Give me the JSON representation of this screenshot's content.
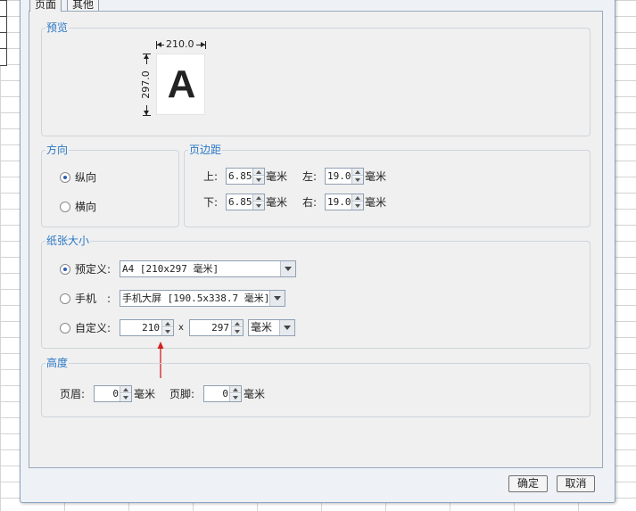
{
  "tabs": [
    {
      "label": "页面",
      "active": true
    },
    {
      "label": "其他",
      "active": false
    }
  ],
  "preview": {
    "title": "预览",
    "width_label": "210.0",
    "height_label": "297.0",
    "letter": "A"
  },
  "orientation": {
    "title": "方向",
    "portrait_label": "纵向",
    "landscape_label": "横向",
    "selected": "portrait"
  },
  "margins": {
    "title": "页边距",
    "top_label": "上:",
    "top_value": "6.85",
    "left_label": "左:",
    "left_value": "19.05",
    "bottom_label": "下:",
    "bottom_value": "6.85",
    "right_label": "右:",
    "right_value": "19.05",
    "unit": "毫米"
  },
  "paper": {
    "title": "纸张大小",
    "predefined_label": "预定义:",
    "predefined_value": "A4 [210x297 毫米]",
    "phone_label": "手机",
    "phone_colon": ":",
    "phone_value": "手机大屏 [190.5x338.7 毫米]",
    "custom_label": "自定义:",
    "custom_width": "210",
    "times": "x",
    "custom_height": "297",
    "custom_unit": "毫米",
    "selected": "predefined"
  },
  "height": {
    "title": "高度",
    "header_label": "页眉:",
    "header_value": "0",
    "footer_label": "页脚:",
    "footer_value": "0",
    "unit": "毫米"
  },
  "buttons": {
    "ok": "确定",
    "cancel": "取消"
  },
  "colors": {
    "group_title": "#2a78c6",
    "annotation_arrow": "#d42020"
  }
}
